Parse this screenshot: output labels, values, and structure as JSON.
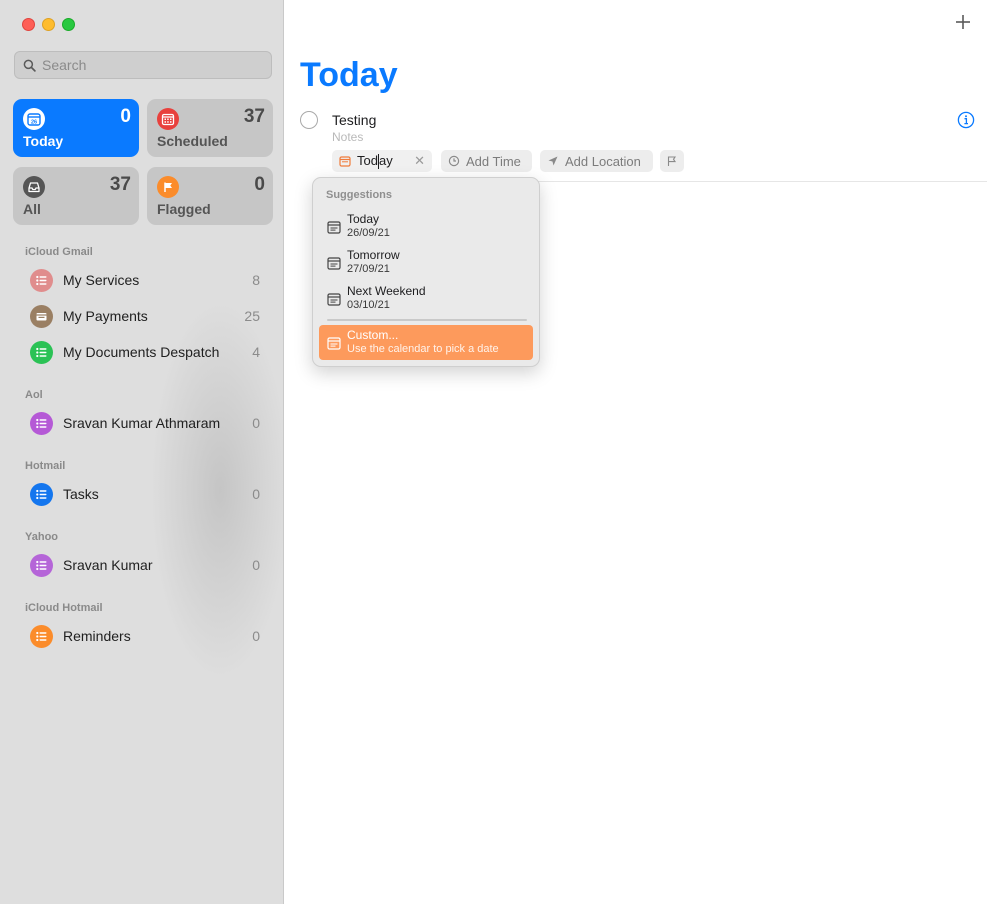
{
  "sidebar": {
    "search": {
      "placeholder": "Search"
    },
    "smart_lists": [
      {
        "label": "Today",
        "count": "0",
        "icon": "calendar-day-icon",
        "color": "#0a7aff",
        "active": true,
        "day": "26"
      },
      {
        "label": "Scheduled",
        "count": "37",
        "icon": "calendar-icon",
        "color": "#e8413d",
        "active": false
      },
      {
        "label": "All",
        "count": "37",
        "icon": "tray-icon",
        "color": "#555555",
        "active": false
      },
      {
        "label": "Flagged",
        "count": "0",
        "icon": "flag-icon",
        "color": "#fb8c2b",
        "active": false
      }
    ],
    "groups": [
      {
        "label": "iCloud Gmail",
        "items": [
          {
            "name": "My Services",
            "count": "8",
            "icon": "list-icon",
            "color": "#e08d8d"
          },
          {
            "name": "My Payments",
            "count": "25",
            "icon": "envelope-icon",
            "color": "#9a7f63"
          },
          {
            "name": "My Documents Despatch",
            "count": "4",
            "icon": "list-icon",
            "color": "#2bc255"
          }
        ]
      },
      {
        "label": "Aol",
        "items": [
          {
            "name": "Sravan Kumar Athmaram",
            "count": "0",
            "icon": "list-icon",
            "color": "#b559d6"
          }
        ]
      },
      {
        "label": "Hotmail",
        "items": [
          {
            "name": "Tasks",
            "count": "0",
            "icon": "list-icon",
            "color": "#1476ee"
          }
        ]
      },
      {
        "label": "Yahoo",
        "items": [
          {
            "name": "Sravan Kumar",
            "count": "0",
            "icon": "list-icon",
            "color": "#b565d8"
          }
        ]
      },
      {
        "label": "iCloud Hotmail",
        "items": [
          {
            "name": "Reminders",
            "count": "0",
            "icon": "list-icon",
            "color": "#fb8c2b"
          }
        ]
      }
    ]
  },
  "main": {
    "title": "Today",
    "task": {
      "title": "Testing",
      "notes_placeholder": "Notes"
    },
    "chips": {
      "date_before": "Tod",
      "date_after": "ay",
      "time": "Add Time",
      "location": "Add Location"
    }
  },
  "dropdown": {
    "header": "Suggestions",
    "items": [
      {
        "name": "Today",
        "date": "26/09/21"
      },
      {
        "name": "Tomorrow",
        "date": "27/09/21"
      },
      {
        "name": "Next Weekend",
        "date": "03/10/21"
      }
    ],
    "custom": {
      "name": "Custom...",
      "description": "Use the calendar to pick a date"
    }
  },
  "colors": {
    "accent": "#0a7aff",
    "highlight": "#fd9a5c"
  }
}
